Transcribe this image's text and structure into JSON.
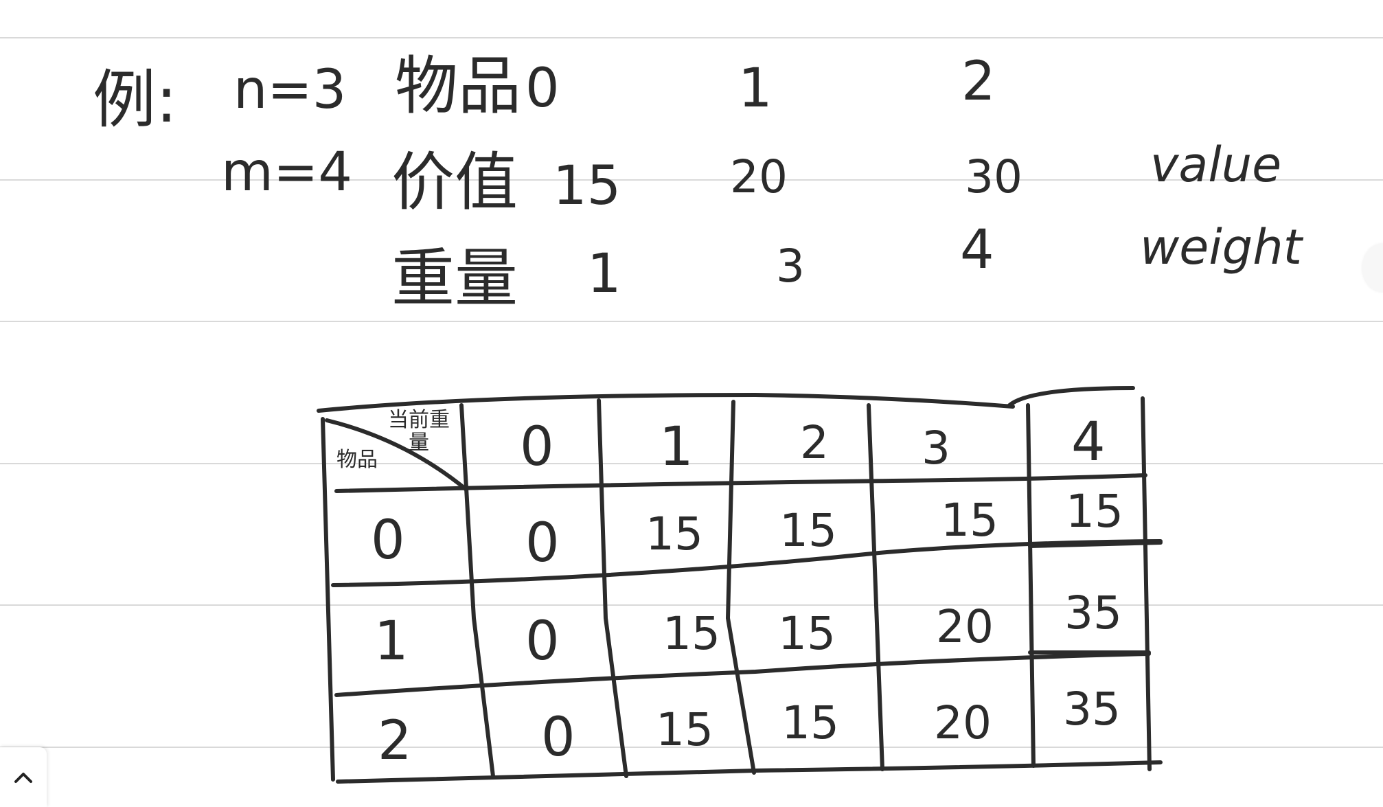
{
  "example": {
    "label": "例:",
    "n_label": "n=3",
    "m_label": "m=4"
  },
  "items_row": {
    "label": "物品",
    "values": [
      "0",
      "1",
      "2"
    ]
  },
  "value_row": {
    "label": "价值",
    "values": [
      "15",
      "20",
      "30"
    ],
    "suffix": "value"
  },
  "weight_row": {
    "label": "重量",
    "values": [
      "1",
      "3",
      "4"
    ],
    "suffix": "weight"
  },
  "dp_table": {
    "corner_top": "当前重量",
    "corner_bottom": "物品",
    "columns": [
      "0",
      "1",
      "2",
      "3",
      "4"
    ],
    "rows": [
      {
        "item": "0",
        "cells": [
          "0",
          "15",
          "15",
          "15",
          "15"
        ]
      },
      {
        "item": "1",
        "cells": [
          "0",
          "15",
          "15",
          "20",
          "35"
        ]
      },
      {
        "item": "2",
        "cells": [
          "0",
          "15",
          "15",
          "20",
          "35"
        ]
      }
    ]
  },
  "icons": {
    "collapse": "chevron-up-icon"
  }
}
